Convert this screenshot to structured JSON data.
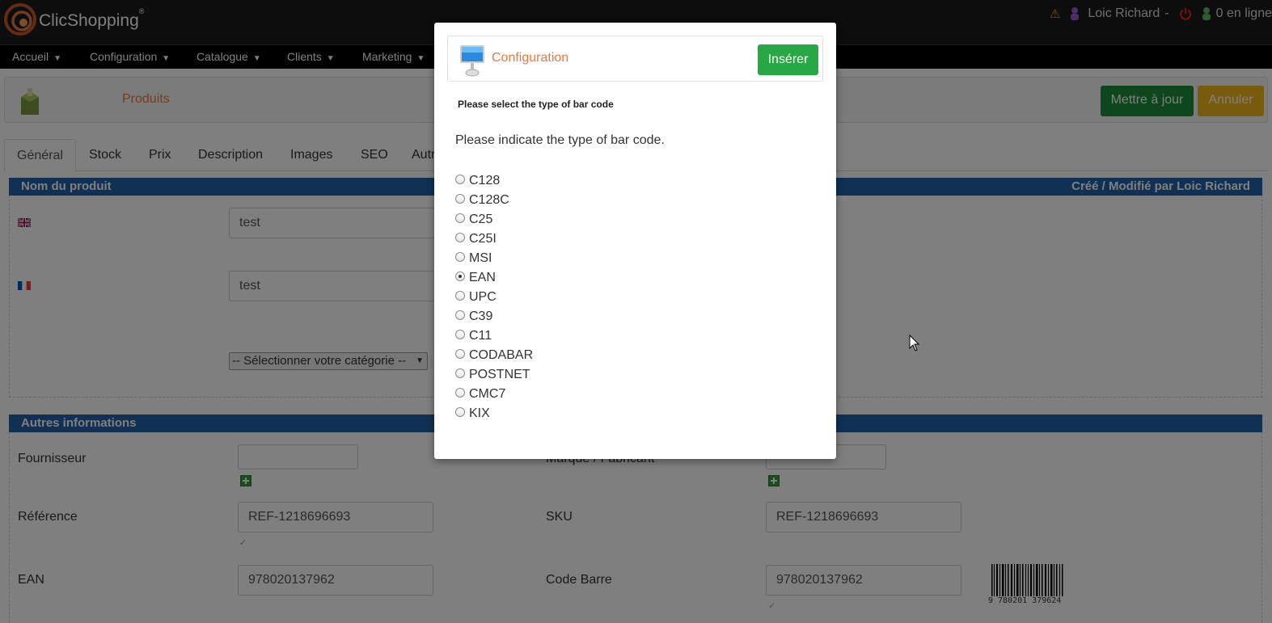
{
  "app": {
    "name": "ClicShopping",
    "registered_mark": "®"
  },
  "user": {
    "name": "Loic Richard",
    "separator": "-",
    "online_label": "0 en ligne"
  },
  "menu": [
    {
      "label": "Accueil"
    },
    {
      "label": "Configuration"
    },
    {
      "label": "Catalogue"
    },
    {
      "label": "Clients"
    },
    {
      "label": "Marketing"
    }
  ],
  "page": {
    "title": "Produits",
    "update_label": "Mettre à jour",
    "cancel_label": "Annuler"
  },
  "tabs": [
    {
      "label": "Général"
    },
    {
      "label": "Stock"
    },
    {
      "label": "Prix"
    },
    {
      "label": "Description"
    },
    {
      "label": "Images"
    },
    {
      "label": "SEO"
    },
    {
      "label": "Autr"
    }
  ],
  "section_name": {
    "title": "Nom du produit",
    "modified_by": "Créé / Modifié par Loic Richard",
    "name_en": "test",
    "name_fr": "test",
    "category_select": "-- Sélectionner votre catégorie --"
  },
  "section_other": {
    "title": "Autres informations",
    "supplier_label": "Fournisseur",
    "supplier_value": "",
    "brand_label": "Marque / Fabricant",
    "brand_value": "",
    "reference_label": "Référence",
    "reference_value": "REF-1218696693",
    "sku_label": "SKU",
    "sku_value": "REF-1218696693",
    "ean_label": "EAN",
    "ean_value": "978020137962",
    "barcode_label": "Code Barre",
    "barcode_value": "978020137962",
    "barcode_image_text": "9 780201 379624"
  },
  "modal": {
    "title": "Configuration",
    "insert_label": "Insérer",
    "subtitle": "Please select the type of bar code",
    "description": "Please indicate the type of bar code.",
    "options": [
      {
        "label": "C128",
        "checked": false
      },
      {
        "label": "C128C",
        "checked": false
      },
      {
        "label": "C25",
        "checked": false
      },
      {
        "label": "C25I",
        "checked": false
      },
      {
        "label": "MSI",
        "checked": false
      },
      {
        "label": "EAN",
        "checked": true
      },
      {
        "label": "UPC",
        "checked": false
      },
      {
        "label": "C39",
        "checked": false
      },
      {
        "label": "C11",
        "checked": false
      },
      {
        "label": "CODABAR",
        "checked": false
      },
      {
        "label": "POSTNET",
        "checked": false
      },
      {
        "label": "CMC7",
        "checked": false
      },
      {
        "label": "KIX",
        "checked": false
      }
    ]
  },
  "colors": {
    "accent_orange": "#f0763a",
    "section_blue": "#2160a9",
    "update_green": "#1d8d3a",
    "insert_green": "#28a745",
    "cancel_yellow": "#f2b61a"
  }
}
